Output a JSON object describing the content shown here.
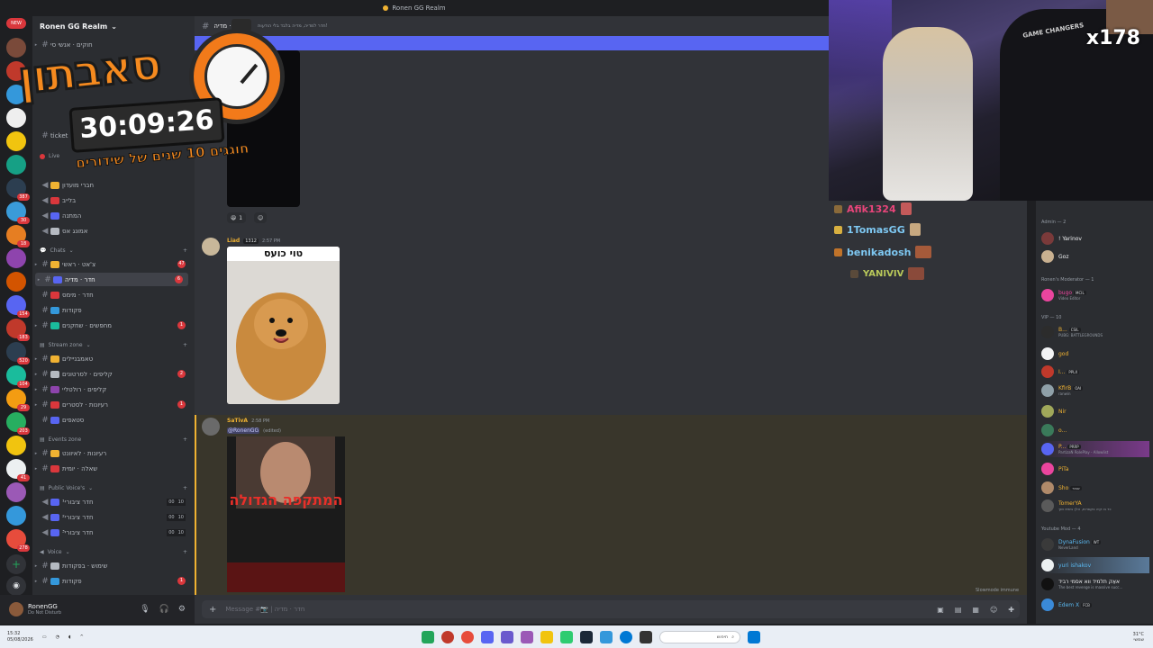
{
  "window": {
    "title": "Ronen GG Realm"
  },
  "server": {
    "name": "Ronen GG Realm",
    "new_badge": "NEW"
  },
  "rail_badges": [
    "387",
    "30",
    "18",
    "154",
    "183",
    "520",
    "104",
    "29",
    "203",
    "41",
    "278"
  ],
  "sidebar": {
    "top_channels": [
      {
        "label": "חוקים · אנשי סי",
        "visible": "ticket"
      },
      {
        "label": "חברי מועדון"
      },
      {
        "label": "בלייב"
      },
      {
        "label": "המתנה"
      },
      {
        "label": "אמונג אס"
      }
    ],
    "categories": {
      "live": "Live",
      "chats": "Chats",
      "stream_zone": "Stream zone",
      "events_zone": "Events zone",
      "public_voices": "Public Voice's",
      "voice": "Voice"
    },
    "chats": [
      {
        "label": "צ'אט · ראשי",
        "mentions": "47"
      },
      {
        "label": "חדר · מדיה",
        "mentions": "6",
        "active": true
      },
      {
        "label": "חדר · מימס"
      },
      {
        "label": "פקודות"
      },
      {
        "label": "מחפשים · שחקנים",
        "mentions": "1"
      }
    ],
    "stream_zone": [
      {
        "label": "טאמבניילים"
      },
      {
        "label": "קליפים · לסרטונים",
        "mentions": "2"
      },
      {
        "label": "קליפים · רולטליי"
      },
      {
        "label": "רעיונות · לסטרים",
        "mentions": "1"
      },
      {
        "label": "סטאפים"
      }
    ],
    "events_zone": [
      {
        "label": "רעיונות · לאיוונט"
      },
      {
        "label": "שאלה · יומית"
      }
    ],
    "public_voices": [
      {
        "label": "חדר ציבורי¹",
        "a": "00",
        "b": "10"
      },
      {
        "label": "חדר ציבורי²",
        "a": "00",
        "b": "10"
      },
      {
        "label": "חדר ציבורי³",
        "a": "00",
        "b": "10"
      }
    ],
    "voice": [
      {
        "label": "שימוש · בפקודות"
      },
      {
        "label": "פקודות",
        "mentions": "1"
      }
    ]
  },
  "user": {
    "name": "RonenGG",
    "status": "Do Not Disturb"
  },
  "channel": {
    "name": "חדר · מדיה",
    "topic": "חדר למדיה, מדיה בלבד בלי הודעות!"
  },
  "messages": [
    {
      "author": "Liad",
      "tag": "1312",
      "time": "2:57 PM",
      "image_caption": "טוי כועס",
      "reaction_count": "1"
    },
    {
      "author": "SaTivA",
      "time": "2:58 PM",
      "mention": "@RonenGG",
      "edited": "(edited)",
      "poster_title": "המתקפה הגדולה"
    }
  ],
  "composer": {
    "placeholder": "Message #📷 | חדר · מדיה"
  },
  "stream_overlay": {
    "hoodie_text": "GAME CHANGERS",
    "streak": "x178",
    "chat": [
      {
        "name": "Afik1324",
        "color": "#e8457a"
      },
      {
        "name": "1TomasGG",
        "color": "#7ec8f2"
      },
      {
        "name": "benikadosh",
        "color": "#7ec8f2"
      },
      {
        "name": "YANIVIV",
        "color": "#b9c95a"
      }
    ]
  },
  "subathon": {
    "title": "סאבתון",
    "timer": "30:09:26",
    "subtitle": "חוגגים 10 שנים של שידורים"
  },
  "members": {
    "groups": [
      {
        "label": "Admin — 2",
        "members": [
          {
            "name": "! Yarinov",
            "color": "#f2f3f5"
          },
          {
            "name": "Goz",
            "color": "#f2f3f5"
          }
        ]
      },
      {
        "label": "Ronen's Moderator — 1",
        "members": [
          {
            "name": "bugo",
            "tag": "MCIL",
            "sub": "Video Editor",
            "color": "#eb459e"
          }
        ]
      },
      {
        "label": "VIP — 10",
        "members": [
          {
            "name": "B...",
            "tag": "CSIL",
            "sub": "PUBG: BATTLEGROUNDS",
            "color": "#f0b232"
          },
          {
            "name": "god",
            "color": "#f0b232"
          },
          {
            "name": "I...",
            "tag": "PPLX",
            "color": "#f0b232"
          },
          {
            "name": "KfirB",
            "tag": "OAI",
            "sub": "ranwin",
            "color": "#f0b232"
          },
          {
            "name": "Nir",
            "color": "#f0b232"
          },
          {
            "name": "o...",
            "color": "#f0b232"
          },
          {
            "name": "P...",
            "tag": "PRRP",
            "sub": "PartizaN RolePlay - Allowlist",
            "color": "#f0b232"
          },
          {
            "name": "PiTa",
            "color": "#f0b232"
          },
          {
            "name": "Sho",
            "tag": "אכזר",
            "color": "#f0b232"
          },
          {
            "name": "TomerYA",
            "sub": "כד בו קיה בקסרות, הלך בשית ושך",
            "color": "#f0b232"
          }
        ]
      },
      {
        "label": "Youtube Mod — 4",
        "members": [
          {
            "name": "DynaFusion",
            "tag": "WT",
            "sub": "NeverLand",
            "color": "#5ab8f0"
          },
          {
            "name": "yuri ishakov",
            "color": "#5ab8f0"
          },
          {
            "name": "אאֵק תלמיד ווא אסמי רביד",
            "sub": "The best revenge is massive succ...",
            "color": "#f2f3f5"
          },
          {
            "name": "Edem X",
            "tag": "FCB",
            "color": "#5ab8f0"
          }
        ]
      }
    ],
    "slowmode": "Slowmode immune"
  },
  "taskbar": {
    "time": "15:32",
    "date": "05/08/2026",
    "search_placeholder": "חיפוש",
    "weather": "31°C",
    "weather_sub": "שמשי"
  }
}
